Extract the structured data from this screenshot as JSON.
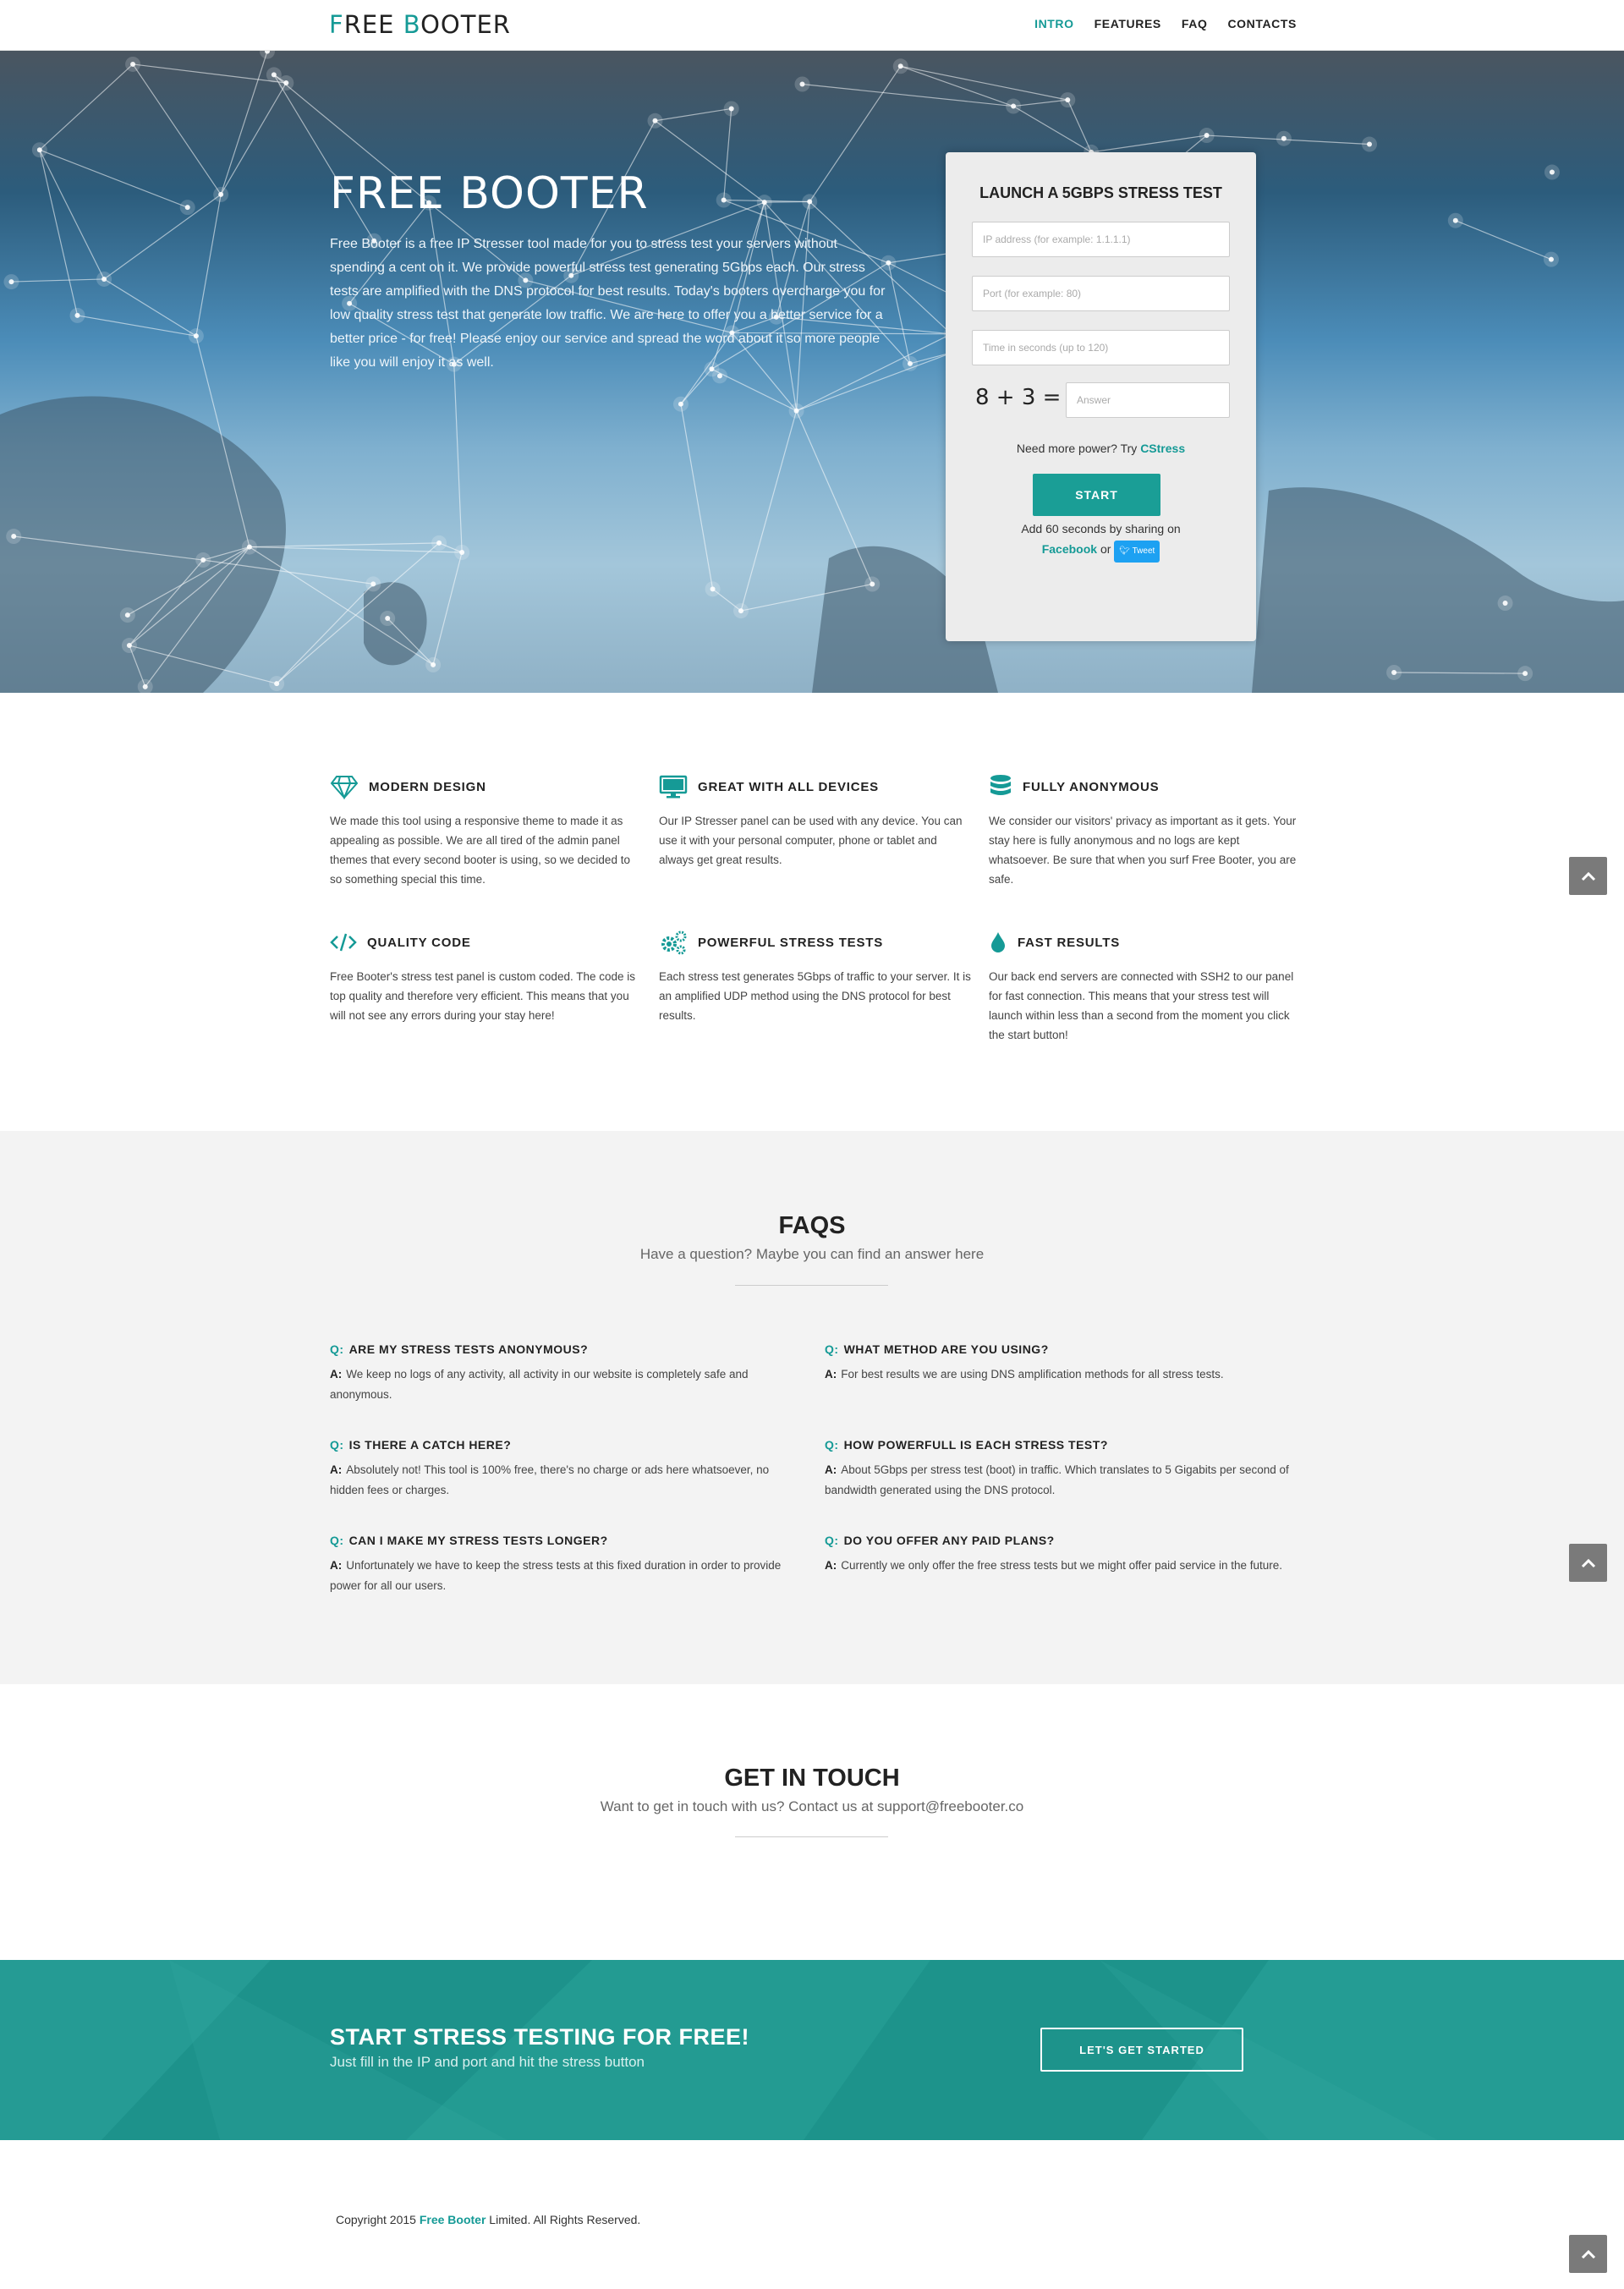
{
  "nav": {
    "logo_first_initial": "F",
    "logo_first_rest": "REE ",
    "logo_second_initial": "B",
    "logo_second_rest": "OOTER",
    "items": [
      "INTRO",
      "FEATURES",
      "FAQ",
      "CONTACTS"
    ],
    "active": "INTRO"
  },
  "hero": {
    "title": "FREE BOOTER",
    "text": "Free Booter is a free IP Stresser tool made for you to stress test your servers without spending a cent on it. We provide powerful stress test generating 5Gbps each. Our stress tests are amplified with the DNS protocol for best results. Today's booters overcharge you for low quality stress test that generate low traffic. We are here to offer you a better service for a better price - for free! Please enjoy our service and spread the word about it so more people like you will enjoy it as well."
  },
  "form": {
    "title": "LAUNCH A 5GBPS STRESS TEST",
    "ip_placeholder": "IP address (for example: 1.1.1.1)",
    "port_placeholder": "Port (for example: 80)",
    "time_placeholder": "Time in seconds (up to 120)",
    "captcha": "8 + 3 =",
    "answer_placeholder": "Answer",
    "more_power_prefix": "Need more power? Try ",
    "more_power_link": "CStress",
    "start_label": "START",
    "share_line1": "Add 60 seconds by sharing on",
    "share_facebook": "Facebook",
    "share_or": " or ",
    "tweet_label": "Tweet"
  },
  "features": [
    {
      "icon": "diamond-icon",
      "title": "MODERN DESIGN",
      "text": "We made this tool using a responsive theme to made it as appealing as possible. We are all tired of the admin panel themes that every second booter is using, so we decided to so something special this time."
    },
    {
      "icon": "monitor-icon",
      "title": "GREAT WITH ALL DEVICES",
      "text": "Our IP Stresser panel can be used with any device. You can use it with your personal computer, phone or tablet and always get great results."
    },
    {
      "icon": "database-icon",
      "title": "FULLY ANONYMOUS",
      "text": "We consider our visitors' privacy as important as it gets. Your stay here is fully anonymous and no logs are kept whatsoever. Be sure that when you surf Free Booter, you are safe."
    },
    {
      "icon": "code-icon",
      "title": "QUALITY CODE",
      "text": "Free Booter's stress test panel is custom coded. The code is top quality and therefore very efficient. This means that you will not see any errors during your stay here!"
    },
    {
      "icon": "gears-icon",
      "title": "POWERFUL STRESS TESTS",
      "text": "Each stress test generates 5Gbps of traffic to your server. It is an amplified UDP method using the DNS protocol for best results."
    },
    {
      "icon": "drop-icon",
      "title": "FAST RESULTS",
      "text": "Our back end servers are connected with SSH2 to our panel for fast connection. This means that your stress test will launch within less than a second from the moment you click the start button!"
    }
  ],
  "faqs": {
    "title": "FAQS",
    "subtitle": "Have a question? Maybe you can find an answer here",
    "q_label": "Q:",
    "a_label": "A:",
    "items": [
      {
        "q": "ARE MY STRESS TESTS ANONYMOUS?",
        "a": "We keep no logs of any activity, all activity in our website is completely safe and anonymous."
      },
      {
        "q": "WHAT METHOD ARE YOU USING?",
        "a": "For best results we are using DNS amplification methods for all stress tests."
      },
      {
        "q": "IS THERE A CATCH HERE?",
        "a": "Absolutely not! This tool is 100% free, there's no charge or ads here whatsoever, no hidden fees or charges."
      },
      {
        "q": "HOW POWERFULL IS EACH STRESS TEST?",
        "a": "About 5Gbps per stress test (boot) in traffic. Which translates to 5 Gigabits per second of bandwidth generated using the DNS protocol."
      },
      {
        "q": "CAN I MAKE MY STRESS TESTS LONGER?",
        "a": "Unfortunately we have to keep the stress tests at this fixed duration in order to provide power for all our users."
      },
      {
        "q": "DO YOU OFFER ANY PAID PLANS?",
        "a": "Currently we only offer the free stress tests but we might offer paid service in the future."
      }
    ]
  },
  "contact": {
    "title": "GET IN TOUCH",
    "subtitle": "Want to get in touch with us? Contact us at support@freebooter.co"
  },
  "cta": {
    "title": "START STRESS TESTING FOR FREE!",
    "subtitle": "Just fill in the IP and port and hit the stress button",
    "button": "LET'S GET STARTED"
  },
  "footer": {
    "prefix": "Copyright 2015 ",
    "brand": "Free Booter",
    "suffix": " Limited. All Rights Reserved."
  },
  "colors": {
    "accent": "#159a96",
    "cta_bg": "#1f978f",
    "faq_bg": "#f3f3f3"
  }
}
